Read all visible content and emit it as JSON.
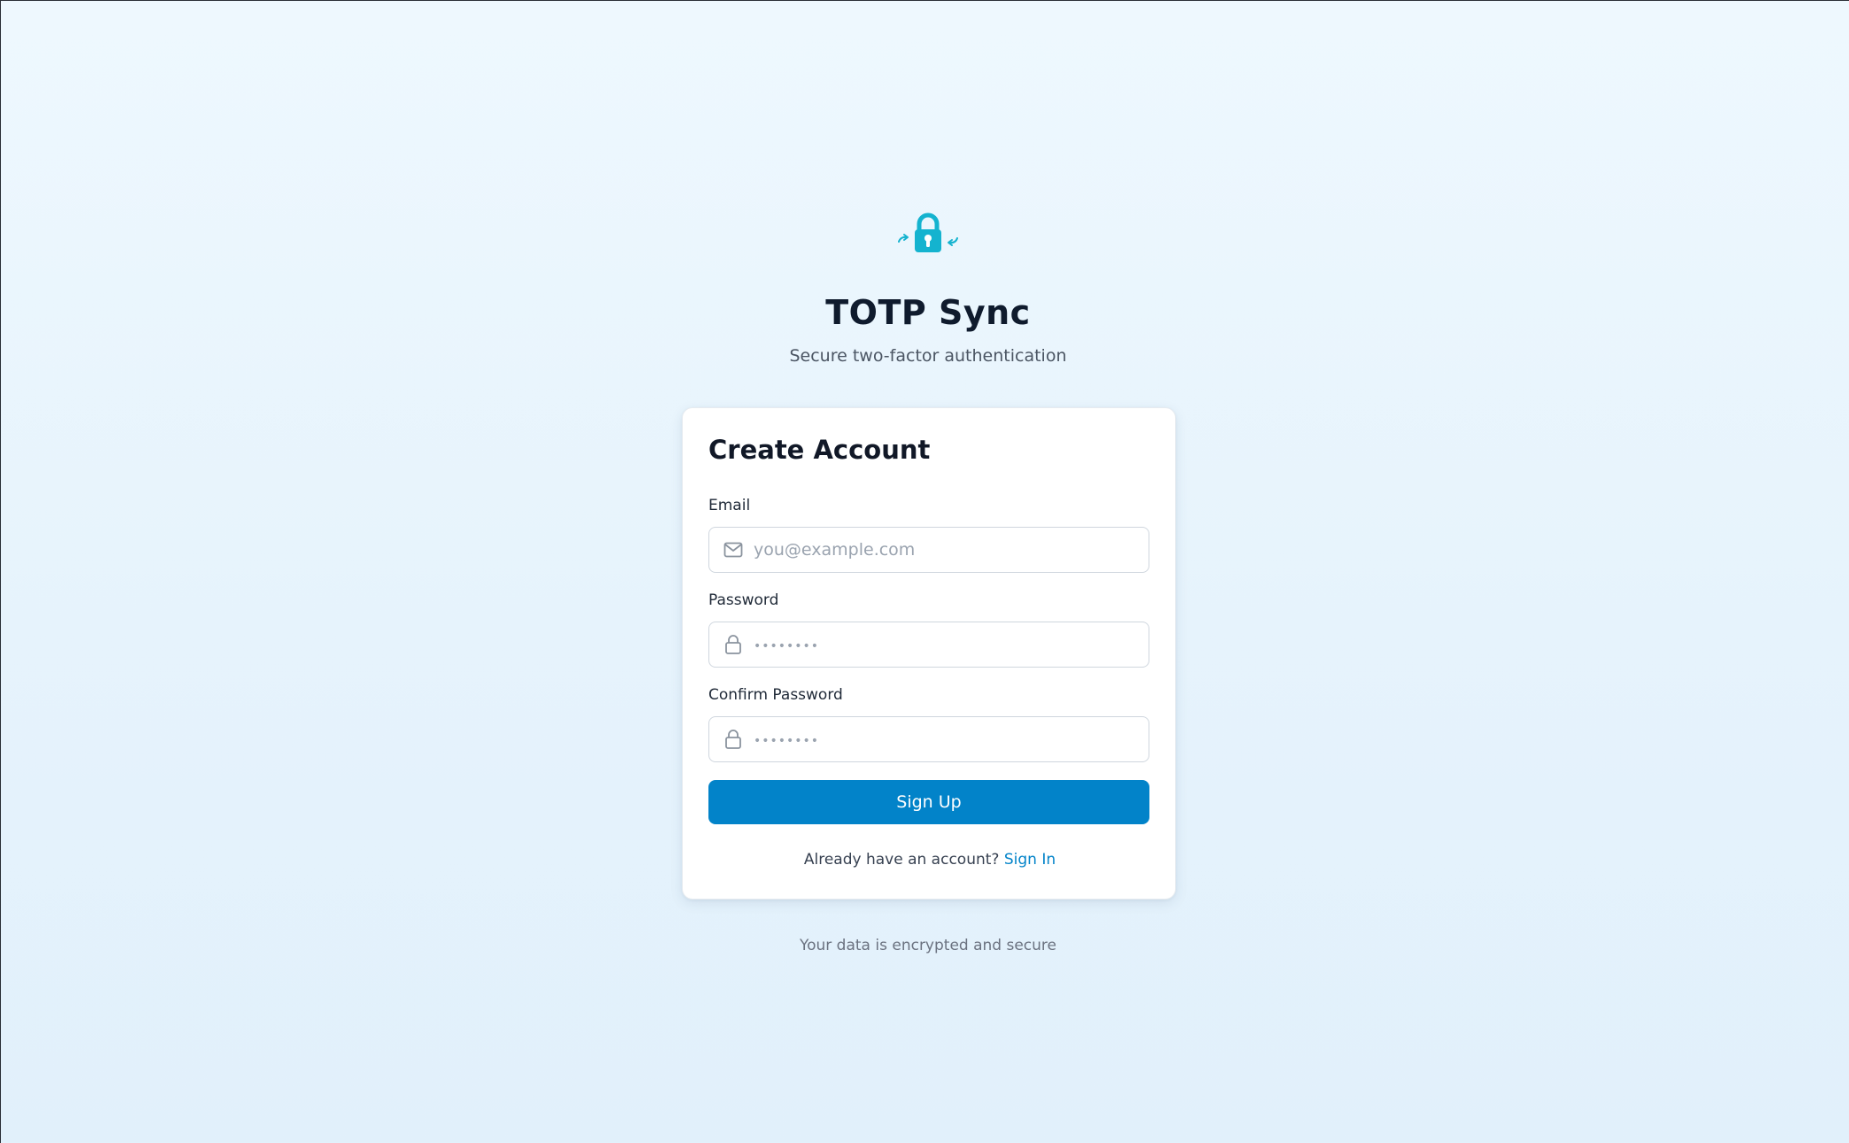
{
  "app": {
    "title": "TOTP Sync",
    "subtitle": "Secure two-factor authentication",
    "logo_icon": "lock-sync-icon",
    "accent_color": "#14b3cf"
  },
  "form": {
    "title": "Create Account",
    "email": {
      "label": "Email",
      "placeholder": "you@example.com",
      "value": "",
      "icon": "mail-icon"
    },
    "password": {
      "label": "Password",
      "placeholder": "••••••••",
      "value": "",
      "icon": "lock-icon"
    },
    "confirm_password": {
      "label": "Confirm Password",
      "placeholder": "••••••••",
      "value": "",
      "icon": "lock-icon"
    },
    "submit_label": "Sign Up",
    "submit_color": "#0283c9",
    "switch_prompt": "Already have an account?",
    "switch_link": "Sign In"
  },
  "footer": {
    "note": "Your data is encrypted and secure"
  }
}
